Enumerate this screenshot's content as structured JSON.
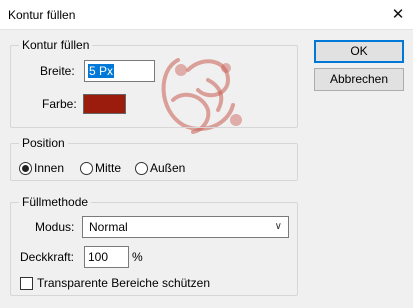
{
  "dialog": {
    "title": "Kontur füllen",
    "close_glyph": "✕"
  },
  "stroke_group": {
    "legend": "Kontur füllen",
    "width_label": "Breite:",
    "width_value": "5 Px",
    "color_label": "Farbe:",
    "color_value": "#9b1b0d"
  },
  "position_group": {
    "legend": "Position",
    "options": [
      {
        "label": "Innen",
        "selected": true
      },
      {
        "label": "Mitte",
        "selected": false
      },
      {
        "label": "Außen",
        "selected": false
      }
    ]
  },
  "blend_group": {
    "legend": "Füllmethode",
    "mode_label": "Modus:",
    "mode_value": "Normal",
    "opacity_label": "Deckkraft:",
    "opacity_value": "100",
    "opacity_unit": "%",
    "preserve_transparency_label": "Transparente Bereiche schützen",
    "preserve_transparency_checked": false
  },
  "buttons": {
    "ok": "OK",
    "cancel": "Abbrechen"
  },
  "icons": {
    "close": "close-icon",
    "dropdown": "chevron-down-icon"
  }
}
